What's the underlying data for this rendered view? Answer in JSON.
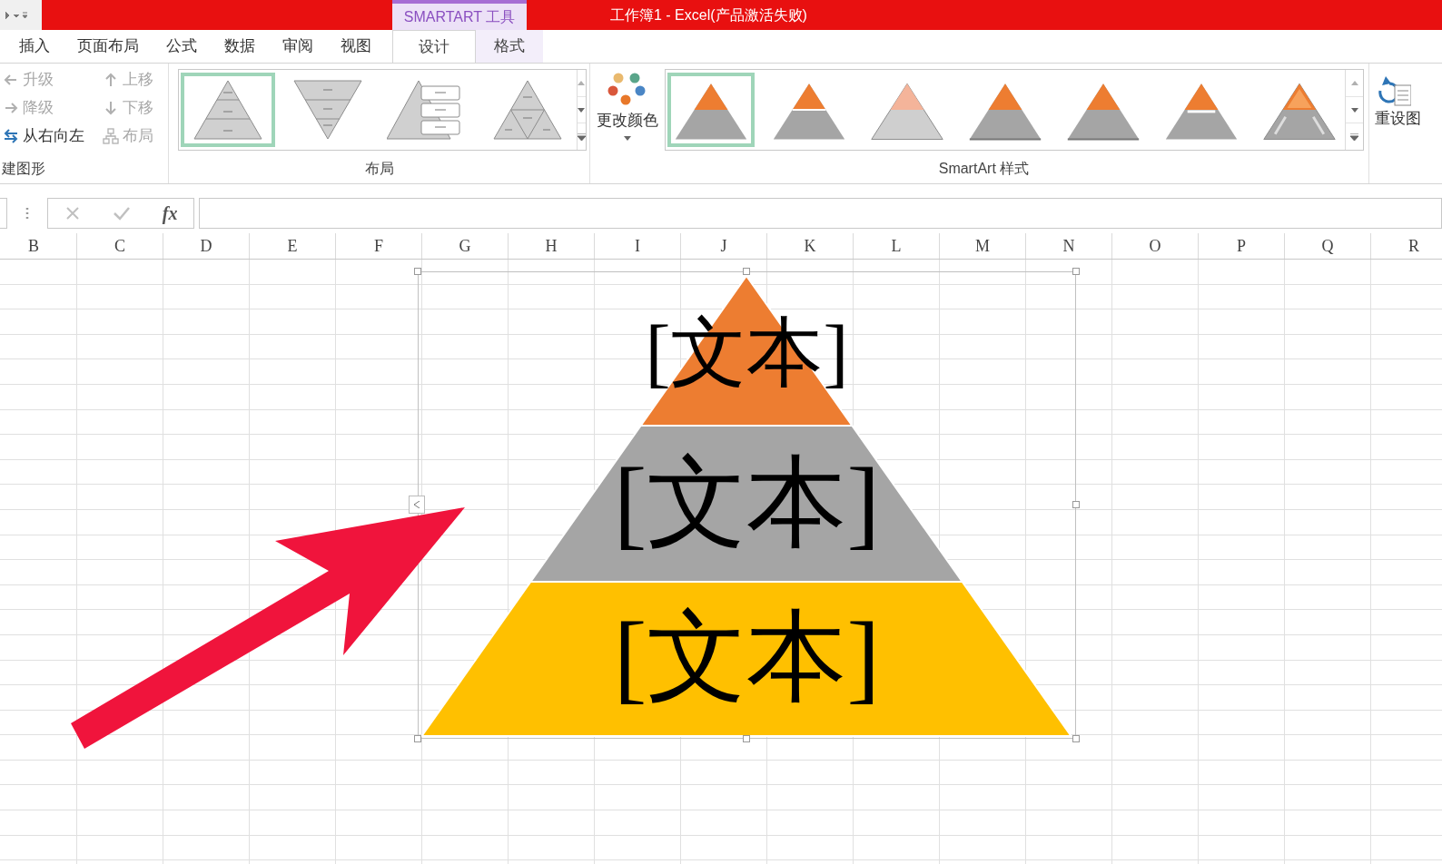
{
  "window": {
    "title": "工作簿1 -  Excel(产品激活失败)",
    "context_tab": "SMARTART 工具"
  },
  "tabs": [
    {
      "label": "插入",
      "selected": false,
      "contextual": false
    },
    {
      "label": "页面布局",
      "selected": false,
      "contextual": false
    },
    {
      "label": "公式",
      "selected": false,
      "contextual": false
    },
    {
      "label": "数据",
      "selected": false,
      "contextual": false
    },
    {
      "label": "审阅",
      "selected": false,
      "contextual": false
    },
    {
      "label": "视图",
      "selected": false,
      "contextual": false
    },
    {
      "label": "设计",
      "selected": true,
      "contextual": true
    },
    {
      "label": "格式",
      "selected": false,
      "contextual": true
    }
  ],
  "create_graphic": {
    "label": "建图形",
    "buttons": [
      {
        "label": "升级",
        "kind": "left",
        "disabled": true
      },
      {
        "label": "降级",
        "kind": "right",
        "disabled": true
      },
      {
        "label": "从右向左",
        "kind": "swap",
        "disabled": false
      },
      {
        "label": "上移",
        "kind": "up",
        "disabled": true
      },
      {
        "label": "下移",
        "kind": "down",
        "disabled": true
      },
      {
        "label": "布局",
        "kind": "layout",
        "disabled": true
      }
    ]
  },
  "layouts": {
    "label": "布局",
    "items": [
      {
        "kind": "pyramid",
        "selected": true
      },
      {
        "kind": "inverted",
        "selected": false
      },
      {
        "kind": "list",
        "selected": false
      },
      {
        "kind": "segmented",
        "selected": false
      }
    ]
  },
  "change_colors": {
    "label": "更改颜色"
  },
  "styles": {
    "label": "SmartArt 样式",
    "items": [
      {
        "kind": "flat",
        "selected": true
      },
      {
        "kind": "gap",
        "selected": false
      },
      {
        "kind": "light",
        "selected": false
      },
      {
        "kind": "shade",
        "selected": false
      },
      {
        "kind": "shade",
        "selected": false
      },
      {
        "kind": "inset",
        "selected": false
      },
      {
        "kind": "bevel",
        "selected": false
      }
    ]
  },
  "reset": {
    "label": "重设图"
  },
  "formula_bar": {
    "fx": "fx"
  },
  "columns": [
    "B",
    "C",
    "D",
    "E",
    "F",
    "G",
    "H",
    "I",
    "J",
    "K",
    "L",
    "M",
    "N",
    "O",
    "P",
    "Q",
    "R"
  ],
  "pyramid": [
    {
      "text": "[文本]",
      "color": "#ed7d31"
    },
    {
      "text": "[文本]",
      "color": "#a5a5a5"
    },
    {
      "text": "[文本]",
      "color": "#ffc000"
    }
  ]
}
